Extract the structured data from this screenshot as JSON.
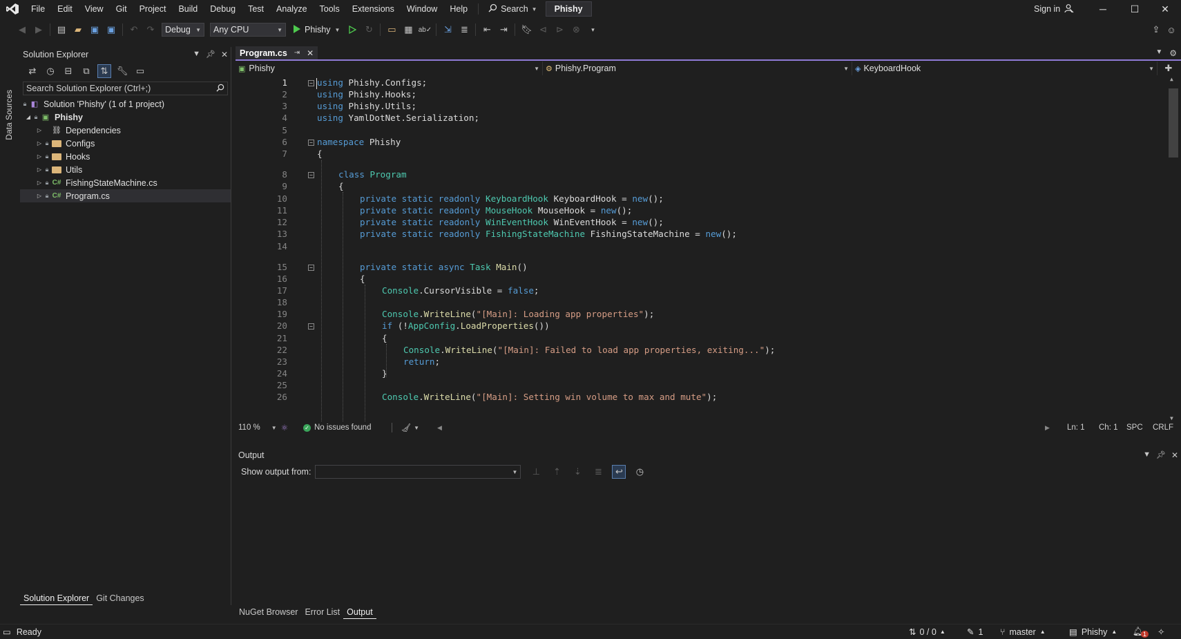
{
  "menubar": {
    "items": [
      "File",
      "Edit",
      "View",
      "Git",
      "Project",
      "Build",
      "Debug",
      "Test",
      "Analyze",
      "Tools",
      "Extensions",
      "Window",
      "Help"
    ],
    "search_label": "Search",
    "solution_name": "Phishy",
    "signin_label": "Sign in"
  },
  "toolbar": {
    "config": "Debug",
    "platform": "Any CPU",
    "run_target": "Phishy"
  },
  "side_strip": {
    "data_sources": "Data Sources"
  },
  "solution_explorer": {
    "title": "Solution Explorer",
    "search_placeholder": "Search Solution Explorer (Ctrl+;)",
    "solution_label": "Solution 'Phishy' (1 of 1 project)",
    "project": "Phishy",
    "items": [
      "Dependencies",
      "Configs",
      "Hooks",
      "Utils",
      "FishingStateMachine.cs",
      "Program.cs"
    ],
    "tabs": [
      "Solution Explorer",
      "Git Changes"
    ]
  },
  "editor": {
    "tab_label": "Program.cs",
    "nav": {
      "project": "Phishy",
      "type": "Phishy.Program",
      "member": "KeyboardHook"
    },
    "line_numbers": [
      "1",
      "2",
      "3",
      "4",
      "5",
      "6",
      "7",
      "8",
      "9",
      "10",
      "11",
      "12",
      "13",
      "14",
      "15",
      "16",
      "17",
      "18",
      "19",
      "20",
      "21",
      "22",
      "23",
      "24",
      "25",
      "26"
    ],
    "zoom": "110 %",
    "issues": "No issues found",
    "ln": "Ln: 1",
    "ch": "Ch: 1",
    "spc": "SPC",
    "crlf": "CRLF"
  },
  "code": {
    "l1": [
      "using",
      " Phishy.Configs;"
    ],
    "l2": [
      "using",
      " Phishy.Hooks;"
    ],
    "l3": [
      "using",
      " Phishy.Utils;"
    ],
    "l4": [
      "using",
      " YamlDotNet.Serialization;"
    ],
    "l6": [
      "namespace",
      " Phishy"
    ],
    "l7": "{",
    "l8": [
      "class",
      "Program"
    ],
    "l9": "{",
    "l10": [
      "private static readonly",
      "KeyboardHook",
      " KeyboardHook = ",
      "new",
      "();"
    ],
    "l11": [
      "private static readonly",
      "MouseHook",
      " MouseHook = ",
      "new",
      "();"
    ],
    "l12": [
      "private static readonly",
      "WinEventHook",
      " WinEventHook = ",
      "new",
      "();"
    ],
    "l13": [
      "private static readonly",
      "FishingStateMachine",
      " FishingStateMachine = ",
      "new",
      "();"
    ],
    "l15": [
      "private static async",
      "Task",
      "Main",
      "()"
    ],
    "l16": "{",
    "l17": [
      "Console",
      ".CursorVisible = ",
      "false",
      ";"
    ],
    "l19": [
      "Console",
      ".",
      "WriteLine",
      "(",
      "\"[Main]: Loading app properties\"",
      ");"
    ],
    "l20": [
      "if",
      " (!",
      "AppConfig",
      ".",
      "LoadProperties",
      "())"
    ],
    "l21": "{",
    "l22": [
      "Console",
      ".",
      "WriteLine",
      "(",
      "\"[Main]: Failed to load app properties, exiting...\"",
      ");"
    ],
    "l23": [
      "return",
      ";"
    ],
    "l24": "}",
    "l26": [
      "Console",
      ".",
      "WriteLine",
      "(",
      "\"[Main]: Setting win volume to max and mute\"",
      ");"
    ]
  },
  "output": {
    "title": "Output",
    "show_from_label": "Show output from:",
    "tabs": [
      "NuGet Browser",
      "Error List",
      "Output"
    ]
  },
  "statusbar": {
    "ready": "Ready",
    "sync": "0 / 0",
    "edits": "1",
    "branch": "master",
    "repo": "Phishy",
    "notifications": "1"
  },
  "colors": {
    "background": "#1f1f1f",
    "keyword": "#569cd6",
    "type": "#4ec9b0",
    "string": "#d69d85",
    "method": "#dcdcaa",
    "accent": "#8f7bd6",
    "run_green": "#4ec94e"
  }
}
